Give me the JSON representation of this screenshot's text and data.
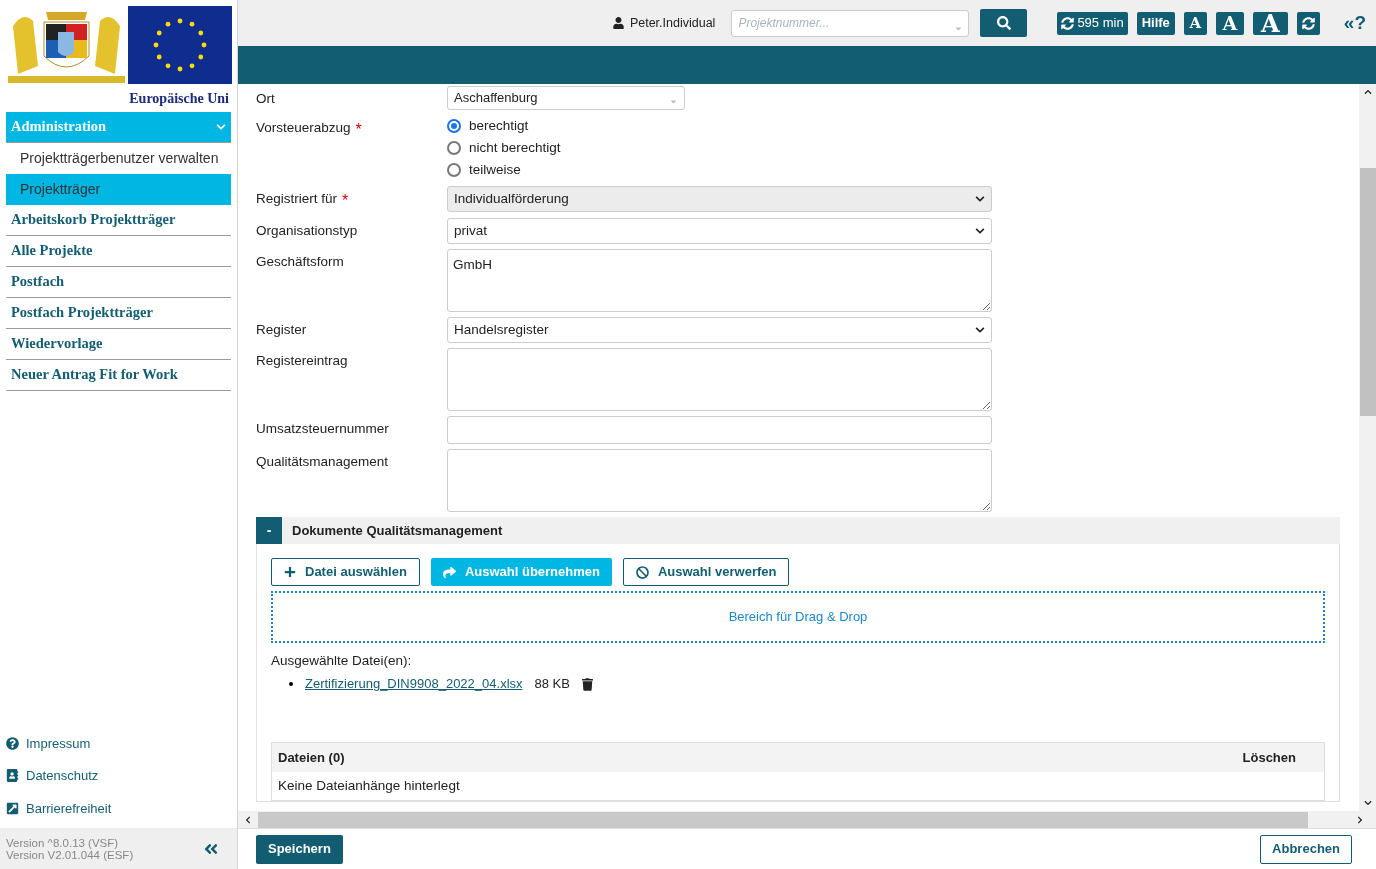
{
  "header": {
    "user": "Peter.Individual",
    "search": {
      "placeholder": "Projektnummer..."
    },
    "session": "595 min",
    "help": "Hilfe",
    "font_sizes": [
      "A",
      "A",
      "A"
    ],
    "collapse": "«?"
  },
  "sidebar": {
    "logo_caption": "Europäische Uni",
    "nav": [
      {
        "label": "Administration",
        "expanded": true,
        "selected": true,
        "children": [
          {
            "label": "Projektträgerbenutzer verwalten",
            "selected": false
          },
          {
            "label": "Projektträger",
            "selected": true
          }
        ]
      },
      {
        "label": "Arbeitskorb Projektträger",
        "selected": false
      },
      {
        "label": "Alle Projekte",
        "selected": false
      },
      {
        "label": "Postfach",
        "selected": false
      },
      {
        "label": "Postfach Projektträger",
        "selected": false
      },
      {
        "label": "Wiedervorlage",
        "selected": false
      },
      {
        "label": "Neuer Antrag Fit for Work",
        "selected": false
      }
    ],
    "links": [
      {
        "kind": "help",
        "label": "Impressum"
      },
      {
        "kind": "privacy",
        "label": "Datenschutz"
      },
      {
        "kind": "accessibility",
        "label": "Barrierefreiheit"
      }
    ],
    "versions": [
      "Version ^8.0.13 (VSF)",
      "Version V2.01.044 (ESF)"
    ]
  },
  "form": [
    {
      "kind": "combo",
      "label": "Ort",
      "value": "Aschaffenburg"
    },
    {
      "kind": "radio",
      "label": "Vorsteuerabzug",
      "required_mark": "*",
      "options": [
        {
          "label": "berechtigt",
          "selected": true
        },
        {
          "label": "nicht berechtigt",
          "selected": false
        },
        {
          "label": "teilweise",
          "selected": false
        }
      ]
    },
    {
      "kind": "select",
      "label": "Registriert für",
      "required_mark": "*",
      "value": "Individualförderung",
      "disabled": true
    },
    {
      "kind": "select",
      "label": "Organisationstyp",
      "value": "privat",
      "disabled": false
    },
    {
      "kind": "textarea",
      "label": "Geschäftsform",
      "value": "GmbH"
    },
    {
      "kind": "select",
      "label": "Register",
      "value": "Handelsregister",
      "disabled": false
    },
    {
      "kind": "textarea",
      "label": "Registereintrag"
    },
    {
      "kind": "text",
      "label": "Umsatzsteuernummer"
    },
    {
      "kind": "textarea",
      "label": "Qualitätsmanagement"
    }
  ],
  "section": {
    "toggle": "-",
    "title": "Dokumente Qualitätsmanagement",
    "buttons": [
      {
        "kind": "add",
        "label": "Datei auswählen",
        "selected": false
      },
      {
        "kind": "apply",
        "label": "Auswahl übernehmen",
        "selected": true
      },
      {
        "kind": "discard",
        "label": "Auswahl verwerfen",
        "selected": false
      }
    ],
    "dropzone": "Bereich für Drag & Drop",
    "selected_label": "Ausgewählte Datei(en):",
    "files": [
      {
        "name": "Zertifizierung_DIN9908_2022_04.xlsx",
        "size": "88 KB"
      }
    ],
    "table": {
      "columns": [
        "Dateien (0)",
        "Löschen"
      ],
      "empty": "Keine Dateianhänge hinterlegt"
    }
  },
  "footer": {
    "save": "Speichern",
    "cancel": "Abbrechen"
  }
}
